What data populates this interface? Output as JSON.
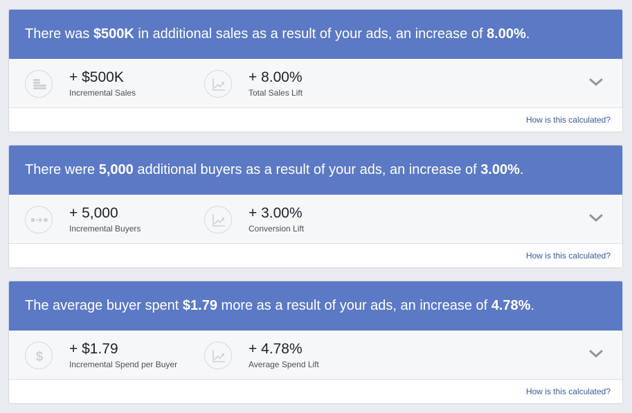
{
  "colors": {
    "header_bg": "#5b79c4",
    "metrics_bg": "#f6f7f9",
    "link": "#365899",
    "icon_gray": "#cdd0d4"
  },
  "cards": [
    {
      "headline": {
        "pre": "There was ",
        "strong1": "$500K",
        "mid": " in additional sales as a result of your ads, an increase of ",
        "strong2": "8.00%",
        "post": "."
      },
      "metrics": [
        {
          "value": "+ $500K",
          "label": "Incremental Sales",
          "icon": "coins-icon"
        },
        {
          "value": "+ 8.00%",
          "label": "Total Sales Lift",
          "icon": "trend-chart-icon"
        }
      ],
      "link": "How is this calculated?"
    },
    {
      "headline": {
        "pre": "There were ",
        "strong1": "5,000",
        "mid": " additional buyers as a result of your ads, an increase of ",
        "strong2": "3.00%",
        "post": "."
      },
      "metrics": [
        {
          "value": "+ 5,000",
          "label": "Incremental Buyers",
          "icon": "conversion-flow-icon"
        },
        {
          "value": "+ 3.00%",
          "label": "Conversion Lift",
          "icon": "trend-chart-icon"
        }
      ],
      "link": "How is this calculated?"
    },
    {
      "headline": {
        "pre": "The average buyer spent ",
        "strong1": "$1.79",
        "mid": " more as a result of your ads, an increase of ",
        "strong2": "4.78%",
        "post": "."
      },
      "metrics": [
        {
          "value": "+ $1.79",
          "label": "Incremental Spend per Buyer",
          "icon": "dollar-icon"
        },
        {
          "value": "+ 4.78%",
          "label": "Average Spend Lift",
          "icon": "trend-chart-icon"
        }
      ],
      "link": "How is this calculated?"
    }
  ]
}
